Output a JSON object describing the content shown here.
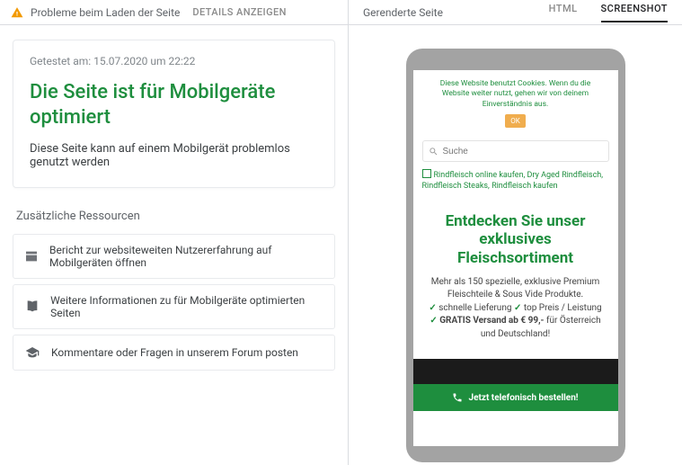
{
  "left": {
    "warning_text": "Probleme beim Laden der Seite",
    "details_link": "DETAILS ANZEIGEN",
    "tested_label": "Getestet am: 15.07.2020 um 22:22",
    "result_title": "Die Seite ist für Mobilgeräte optimiert",
    "result_desc": "Diese Seite kann auf einem Mobilgerät problemlos genutzt werden",
    "resources_heading": "Zusätzliche Ressourcen",
    "resources": [
      "Bericht zur websiteweiten Nutzererfahrung auf Mobilgeräten öffnen",
      "Weitere Informationen zu für Mobilgeräte optimierten Seiten",
      "Kommentare oder Fragen in unserem Forum posten"
    ]
  },
  "right": {
    "section_label": "Gerenderte Seite",
    "tabs": {
      "html": "HTML",
      "screenshot": "SCREENSHOT"
    }
  },
  "phone": {
    "cookie_text": "Diese Website benutzt Cookies. Wenn du die Website weiter nutzt, gehen wir von deinem Einverständnis aus.",
    "cookie_btn": "OK",
    "search_placeholder": "Suche",
    "alt_text": "Rindfleisch online kaufen, Dry Aged Rindfleisch, Rindfleisch Steaks, Rindfleisch kaufen",
    "hero_title": "Entdecken Sie unser exklusives Fleischsortiment",
    "hero_line1": "Mehr als 150 spezielle, exklusive Premium Fleischteile & Sous Vide Produkte.",
    "hero_b1": "schnelle Lieferung",
    "hero_b2": "top Preis / Leistung",
    "hero_b3_prefix": "GRATIS Versand ab € 99,-",
    "hero_b3_suffix": " für Österreich und Deutschland!",
    "cta": "Jetzt telefonisch bestellen!"
  }
}
